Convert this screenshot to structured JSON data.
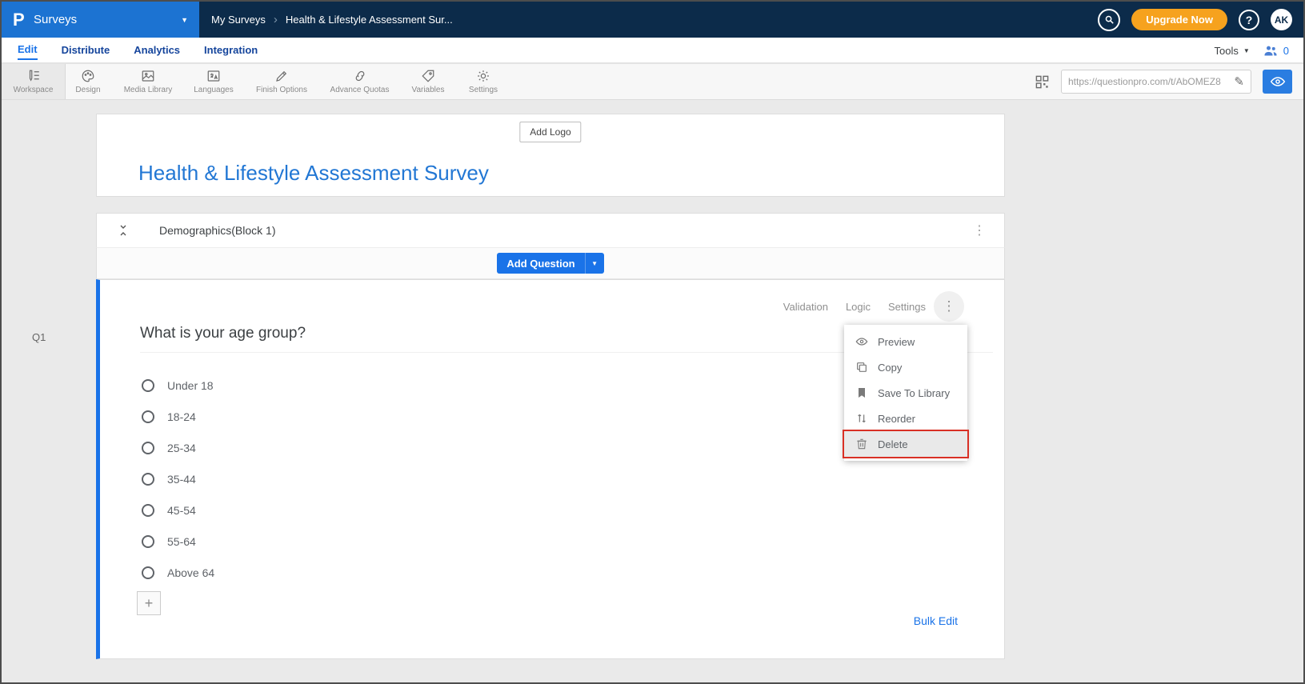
{
  "topbar": {
    "app_name": "Surveys",
    "breadcrumb": [
      "My Surveys",
      "Health & Lifestyle Assessment Sur..."
    ],
    "upgrade_label": "Upgrade Now",
    "help_glyph": "?",
    "avatar_initials": "AK"
  },
  "nav": {
    "tabs": [
      {
        "label": "Edit",
        "active": true
      },
      {
        "label": "Distribute"
      },
      {
        "label": "Analytics"
      },
      {
        "label": "Integration"
      }
    ],
    "tools_label": "Tools",
    "collaborator_count": "0"
  },
  "toolbar": {
    "items": [
      {
        "label": "Workspace",
        "icon": "workspace-icon",
        "selected": true
      },
      {
        "label": "Design",
        "icon": "palette-icon"
      },
      {
        "label": "Media Library",
        "icon": "image-icon"
      },
      {
        "label": "Languages",
        "icon": "translate-icon"
      },
      {
        "label": "Finish Options",
        "icon": "pencil-icon"
      },
      {
        "label": "Advance Quotas",
        "icon": "chain-link-icon"
      },
      {
        "label": "Variables",
        "icon": "tag-icon"
      },
      {
        "label": "Settings",
        "icon": "gear-icon"
      }
    ],
    "survey_url": "https://questionpro.com/t/AbOMEZ8"
  },
  "survey": {
    "add_logo_label": "Add Logo",
    "title": "Health & Lifestyle Assessment Survey"
  },
  "block": {
    "title": "Demographics(Block 1)",
    "add_question_label": "Add Question"
  },
  "question": {
    "id": "Q1",
    "text": "What is your age group?",
    "options": [
      "Under 18",
      "18-24",
      "25-34",
      "35-44",
      "45-54",
      "55-64",
      "Above 64"
    ],
    "actions": [
      "Validation",
      "Logic",
      "Settings"
    ],
    "bulk_edit_label": "Bulk Edit"
  },
  "menu": {
    "items": [
      {
        "label": "Preview",
        "icon": "eye-icon"
      },
      {
        "label": "Copy",
        "icon": "copy-icon"
      },
      {
        "label": "Save To Library",
        "icon": "bookmark-icon"
      },
      {
        "label": "Reorder",
        "icon": "reorder-icon"
      },
      {
        "label": "Delete",
        "icon": "trash-icon",
        "highlighted": true
      }
    ]
  },
  "glyphs": {
    "caret_down": "▼",
    "breadcrumb_sep": "›",
    "kebab": "⋮",
    "plus": "+",
    "pencil": "✎",
    "logo": "P"
  },
  "colors": {
    "accent_blue": "#1a73e8",
    "topbar_navy": "#0c2b4a",
    "brand_blue": "#1c73d2",
    "upgrade_orange": "#f6a21e",
    "annotation_red": "#d93025"
  }
}
